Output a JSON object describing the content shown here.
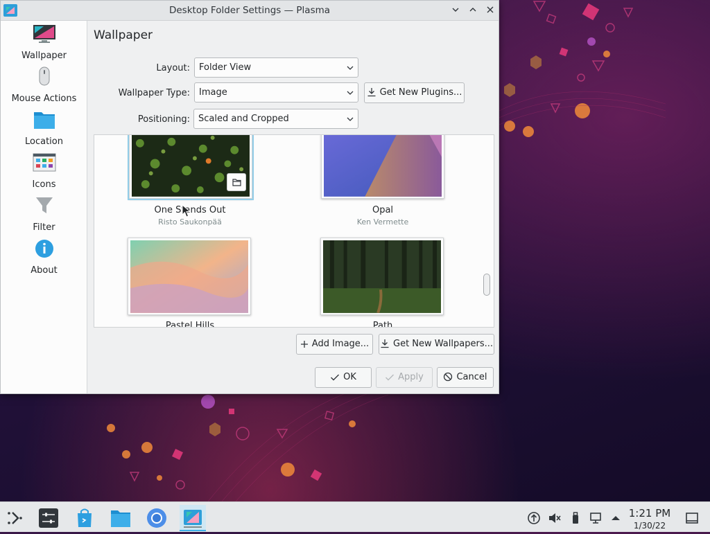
{
  "window": {
    "title": "Desktop Folder Settings — Plasma",
    "controls": {
      "minimize": "﹀",
      "maximize": "︿",
      "close": "✕"
    }
  },
  "sidebar": {
    "items": [
      {
        "label": "Wallpaper",
        "icon": "wallpaper-icon"
      },
      {
        "label": "Mouse Actions",
        "icon": "mouse-icon"
      },
      {
        "label": "Location",
        "icon": "folder-icon"
      },
      {
        "label": "Icons",
        "icon": "icons-icon"
      },
      {
        "label": "Filter",
        "icon": "filter-icon"
      },
      {
        "label": "About",
        "icon": "info-icon"
      }
    ]
  },
  "main": {
    "title": "Wallpaper",
    "layout": {
      "label": "Layout:",
      "value": "Folder View"
    },
    "wallpaper_type": {
      "label": "Wallpaper Type:",
      "value": "Image"
    },
    "get_new_plugins": "Get New Plugins...",
    "positioning": {
      "label": "Positioning:",
      "value": "Scaled and Cropped"
    },
    "wallpapers": [
      {
        "name": "One Stands Out",
        "author": "Risto Saukonpää",
        "selected": true
      },
      {
        "name": "Opal",
        "author": "Ken Vermette",
        "selected": false
      },
      {
        "name": "Pastel Hills",
        "author": "",
        "selected": false
      },
      {
        "name": "Path",
        "author": "",
        "selected": false
      }
    ],
    "add_image": "Add Image...",
    "get_new_wallpapers": "Get New Wallpapers...",
    "ok": "OK",
    "apply": "Apply",
    "cancel": "Cancel"
  },
  "taskbar": {
    "time": "1:21 PM",
    "date": "1/30/22",
    "active_task": "system-settings"
  },
  "colors": {
    "accent": "#3daee9",
    "selection": "#93cee9",
    "window_bg": "#eff0f1",
    "text": "#232629"
  }
}
